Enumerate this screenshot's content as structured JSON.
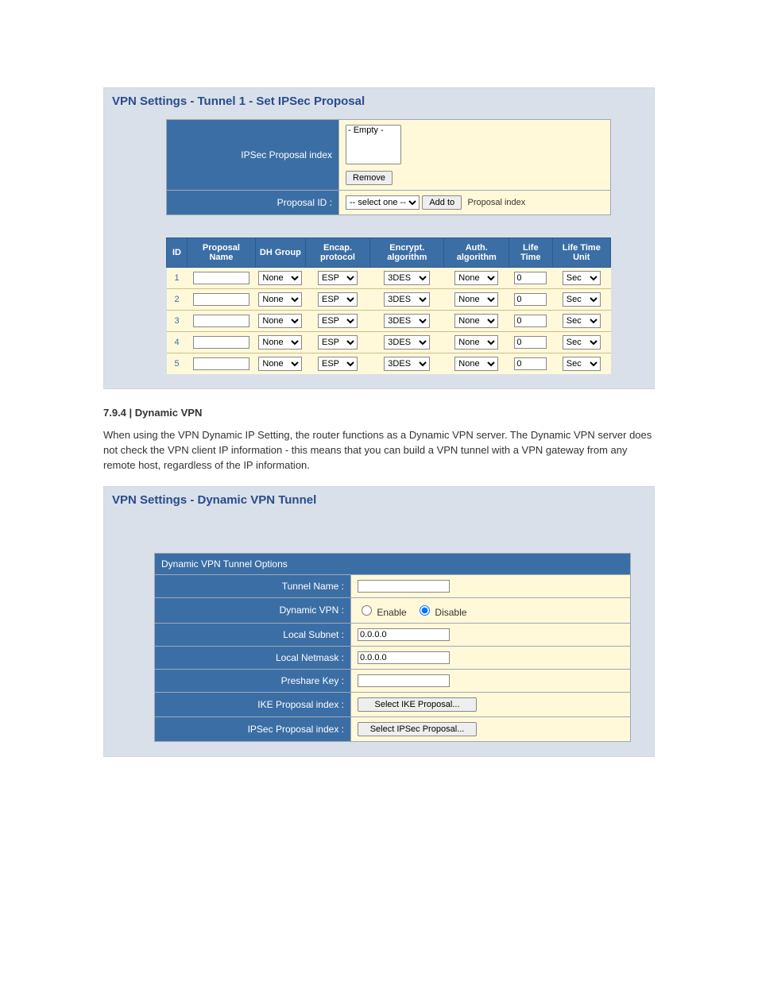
{
  "panel1": {
    "title": "VPN Settings - Tunnel 1 - Set IPSec Proposal",
    "ipsec_index_label": "IPSec Proposal index",
    "ipsec_index_option": "- Empty -",
    "remove_btn": "Remove",
    "proposal_id_label": "Proposal ID :",
    "proposal_id_select": "-- select one --",
    "addto_btn": "Add to",
    "addto_note": "Proposal index"
  },
  "columns": {
    "id": "ID",
    "name": "Proposal Name",
    "dh": "DH Group",
    "encap": "Encap. protocol",
    "encrypt": "Encrypt. algorithm",
    "auth": "Auth. algorithm",
    "life": "Life Time",
    "unit": "Life Time Unit"
  },
  "rows": [
    {
      "id": "1",
      "name": "",
      "dh": "None",
      "encap": "ESP",
      "encrypt": "3DES",
      "auth": "None",
      "life": "0",
      "unit": "Sec"
    },
    {
      "id": "2",
      "name": "",
      "dh": "None",
      "encap": "ESP",
      "encrypt": "3DES",
      "auth": "None",
      "life": "0",
      "unit": "Sec"
    },
    {
      "id": "3",
      "name": "",
      "dh": "None",
      "encap": "ESP",
      "encrypt": "3DES",
      "auth": "None",
      "life": "0",
      "unit": "Sec"
    },
    {
      "id": "4",
      "name": "",
      "dh": "None",
      "encap": "ESP",
      "encrypt": "3DES",
      "auth": "None",
      "life": "0",
      "unit": "Sec"
    },
    {
      "id": "5",
      "name": "",
      "dh": "None",
      "encap": "ESP",
      "encrypt": "3DES",
      "auth": "None",
      "life": "0",
      "unit": "Sec"
    }
  ],
  "section": {
    "num": "7.9.4 |",
    "title": "Dynamic VPN",
    "body": "When using the VPN Dynamic IP Setting, the router functions as a Dynamic VPN server. The Dynamic VPN server does not check the VPN client IP information - this means that you can build a VPN tunnel with a VPN gateway from any remote host, regardless of the IP information."
  },
  "panel2": {
    "title": "VPN Settings - Dynamic VPN Tunnel",
    "opts_hdr": "Dynamic VPN Tunnel Options",
    "tunnel_name_label": "Tunnel Name :",
    "tunnel_name_value": "",
    "dynvpn_label": "Dynamic VPN :",
    "enable_label": "Enable",
    "disable_label": "Disable",
    "local_subnet_label": "Local Subnet :",
    "local_subnet_value": "0.0.0.0",
    "local_netmask_label": "Local Netmask :",
    "local_netmask_value": "0.0.0.0",
    "preshare_label": "Preshare Key :",
    "preshare_value": "",
    "ike_label": "IKE Proposal index :",
    "ike_btn": "Select IKE Proposal...",
    "ipsec_label": "IPSec Proposal index :",
    "ipsec_btn": "Select IPSec Proposal..."
  }
}
